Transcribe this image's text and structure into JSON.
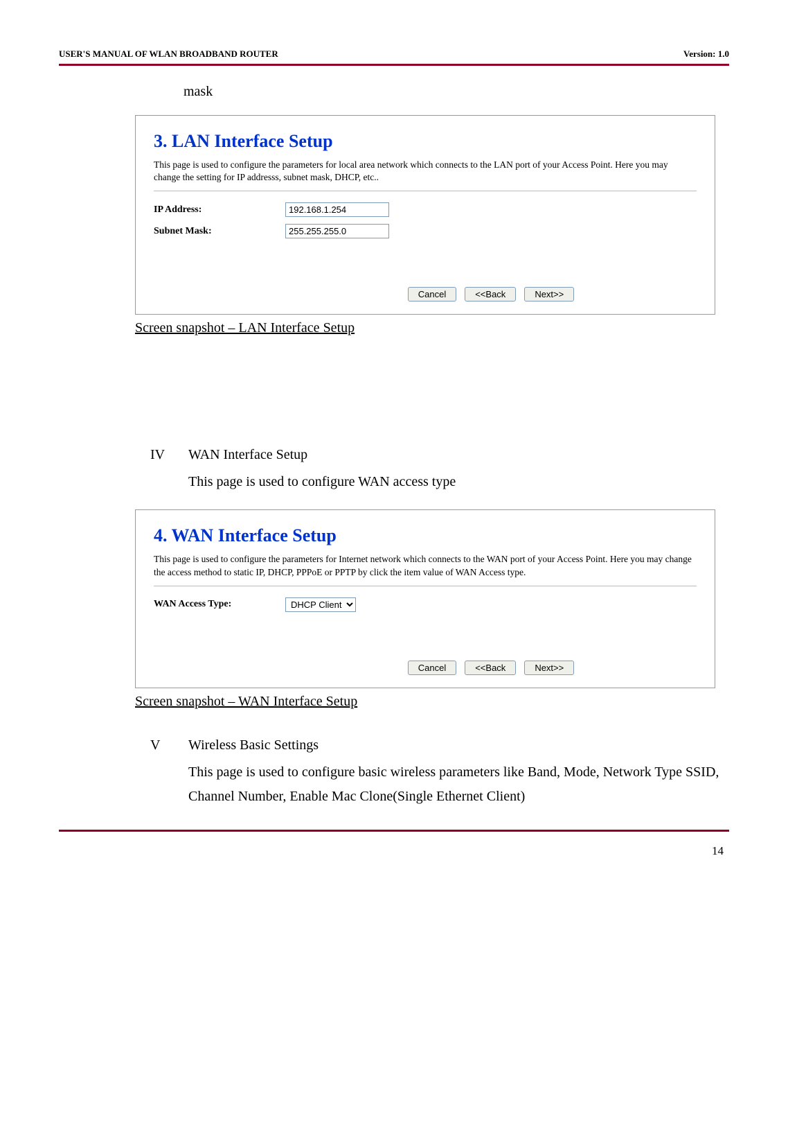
{
  "header": {
    "left": "USER'S MANUAL OF WLAN BROADBAND ROUTER",
    "right": "Version: 1.0"
  },
  "continued_mask": "mask",
  "lan_box": {
    "title": "3. LAN Interface Setup",
    "desc": "This page is used to configure the parameters for local area network which connects to the LAN port of your Access Point. Here you may change the setting for IP addresss, subnet mask, DHCP, etc..",
    "ip_label": "IP Address:",
    "ip_value": "192.168.1.254",
    "mask_label": "Subnet Mask:",
    "mask_value": "255.255.255.0",
    "cancel": "Cancel",
    "back": "<<Back",
    "next": "      Next>>"
  },
  "lan_caption": "Screen snapshot – LAN Interface Setup",
  "section_iv": {
    "roman": "IV",
    "title": "WAN Interface Setup",
    "body": "This page is used to configure WAN access type"
  },
  "wan_box": {
    "title": "4. WAN Interface Setup",
    "desc": "This page is used to configure the parameters for Internet network which connects to the WAN port of your Access Point. Here you may change the access method to static IP, DHCP, PPPoE or PPTP by click the item value of WAN Access type.",
    "access_label": "WAN Access Type:",
    "access_value": "DHCP Client",
    "cancel": "Cancel",
    "back": "<<Back",
    "next": "      Next>>"
  },
  "wan_caption": "Screen snapshot – WAN Interface Setup",
  "section_v": {
    "roman": "V",
    "title": "Wireless Basic Settings",
    "body": "This page is used to configure basic wireless parameters like Band, Mode, Network Type SSID, Channel Number, Enable Mac Clone(Single Ethernet Client)"
  },
  "page_number": "14"
}
